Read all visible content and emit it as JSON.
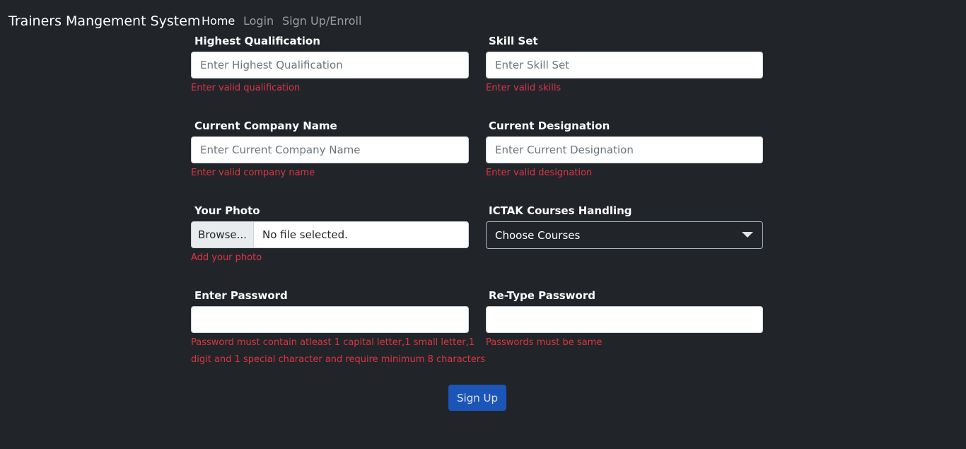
{
  "navbar": {
    "brand": "Trainers Mangement System",
    "links": [
      {
        "label": "Home",
        "active": true
      },
      {
        "label": "Login",
        "active": false
      },
      {
        "label": "Sign Up/Enroll",
        "active": false
      }
    ]
  },
  "form": {
    "qualification": {
      "label": "Highest Qualification",
      "placeholder": "Enter Highest Qualification",
      "error": "Enter valid qualification"
    },
    "skills": {
      "label": "Skill Set",
      "placeholder": "Enter Skill Set",
      "error": "Enter valid skills"
    },
    "company": {
      "label": "Current Company Name",
      "placeholder": "Enter Current Company Name",
      "error": "Enter valid company name"
    },
    "designation": {
      "label": "Current Designation",
      "placeholder": "Enter Current Designation",
      "error": "Enter valid designation"
    },
    "photo": {
      "label": "Your Photo",
      "browse_label": "Browse...",
      "file_status": "No file selected.",
      "error": "Add your photo"
    },
    "courses": {
      "label": "ICTAK Courses Handling",
      "selected": "Choose Courses"
    },
    "password": {
      "label": "Enter Password",
      "value": "",
      "error_line1": "Password must contain atleast 1 capital letter,1 small letter,1",
      "error_line2": "digit and 1 special character and require minimum 8 characters"
    },
    "retype_password": {
      "label": "Re-Type Password",
      "value": "",
      "error": "Passwords must be same"
    },
    "submit_label": "Sign Up"
  },
  "colors": {
    "background": "#212529",
    "error": "#dc3545",
    "primary_button": "#1b55b8"
  }
}
